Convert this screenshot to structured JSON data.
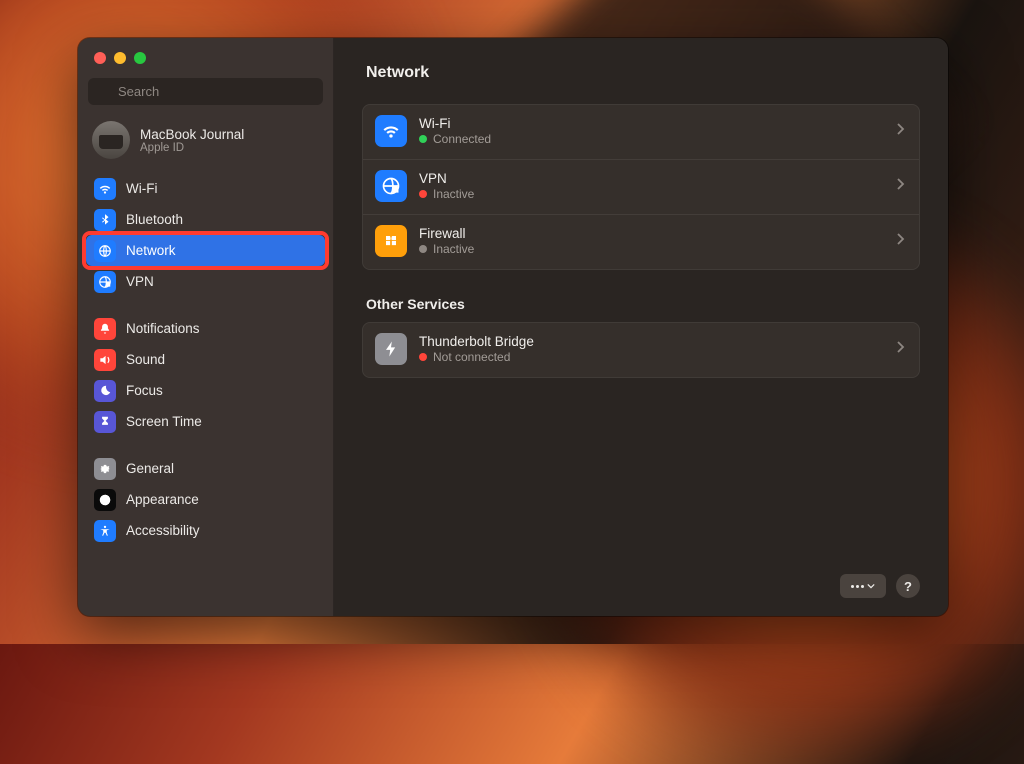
{
  "search": {
    "placeholder": "Search"
  },
  "profile": {
    "name": "MacBook Journal",
    "sub": "Apple ID"
  },
  "sidebar": {
    "items": [
      {
        "label": "Wi-Fi",
        "icon": "wifi",
        "bg": "#1f7cff"
      },
      {
        "label": "Bluetooth",
        "icon": "bluetooth",
        "bg": "#1f7cff"
      },
      {
        "label": "Network",
        "icon": "network",
        "bg": "#1f7cff",
        "active": true,
        "annotated": true
      },
      {
        "label": "VPN",
        "icon": "vpn",
        "bg": "#1f7cff"
      },
      {
        "label": "Notifications",
        "icon": "bell",
        "bg": "#ff453a"
      },
      {
        "label": "Sound",
        "icon": "sound",
        "bg": "#ff453a"
      },
      {
        "label": "Focus",
        "icon": "focus",
        "bg": "#5856d6"
      },
      {
        "label": "Screen Time",
        "icon": "hourglass",
        "bg": "#5856d6"
      },
      {
        "label": "General",
        "icon": "gear",
        "bg": "#8e8e93"
      },
      {
        "label": "Appearance",
        "icon": "appearance",
        "bg": "#0a0a0a"
      },
      {
        "label": "Accessibility",
        "icon": "access",
        "bg": "#1f7cff"
      }
    ]
  },
  "page": {
    "title": "Network",
    "main_group": [
      {
        "title": "Wi-Fi",
        "status": "Connected",
        "dot": "green",
        "icon": "wifi",
        "bg": "#1f7cff"
      },
      {
        "title": "VPN",
        "status": "Inactive",
        "dot": "red",
        "icon": "vpn",
        "bg": "#1f7cff"
      },
      {
        "title": "Firewall",
        "status": "Inactive",
        "dot": "gray",
        "icon": "firewall",
        "bg": "#ff9f0a"
      }
    ],
    "other_header": "Other Services",
    "other_group": [
      {
        "title": "Thunderbolt Bridge",
        "status": "Not connected",
        "dot": "red",
        "icon": "thunderbolt",
        "bg": "#8e8e93"
      }
    ]
  },
  "footer": {
    "help": "?"
  }
}
